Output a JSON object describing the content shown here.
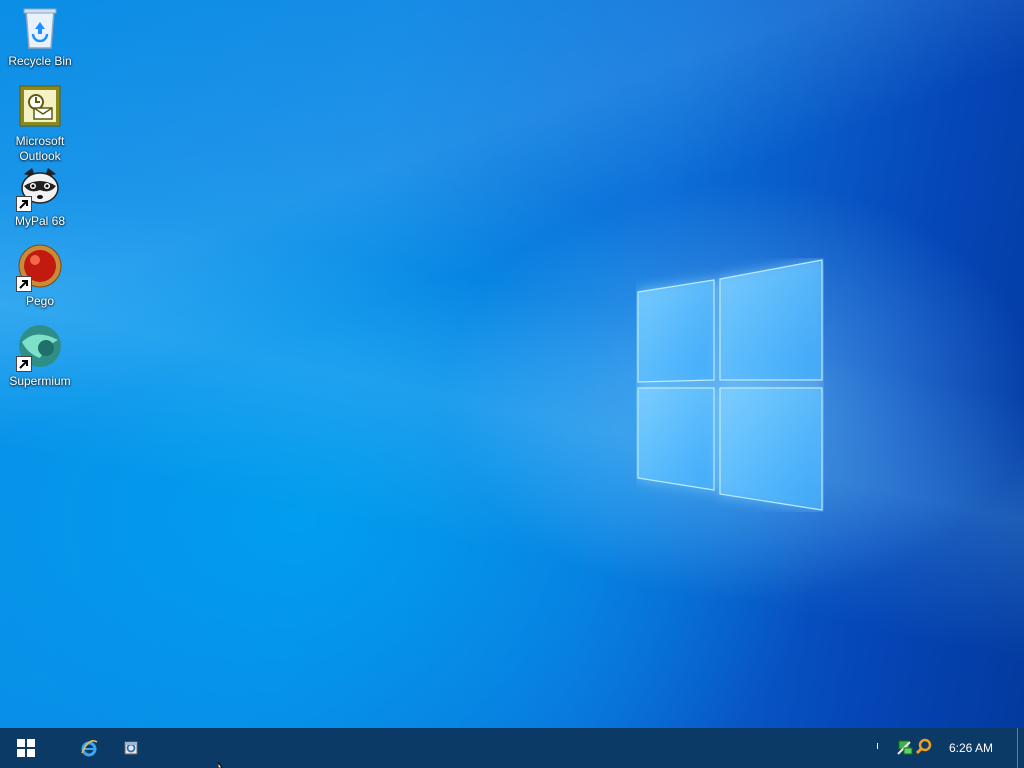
{
  "desktop": {
    "icons": [
      {
        "label": "Recycle Bin",
        "icon": "recycle-bin-icon",
        "shortcut": false
      },
      {
        "label": "Microsoft Outlook",
        "icon": "outlook-icon",
        "shortcut": false
      },
      {
        "label": "MyPal 68",
        "icon": "mypal-raccoon-icon",
        "shortcut": true
      },
      {
        "label": "Pego",
        "icon": "pego-red-orb-icon",
        "shortcut": true
      },
      {
        "label": "Supermium",
        "icon": "supermium-icon",
        "shortcut": true
      }
    ]
  },
  "taskbar": {
    "start_icon": "windows-start-icon",
    "pinned": [
      {
        "icon": "internet-explorer-icon"
      },
      {
        "icon": "generic-app-icon"
      }
    ],
    "tray": {
      "overflow_glyph": "ı",
      "icons": [
        "network-icon",
        "search-magnifier-icon"
      ],
      "clock": "6:26 AM"
    }
  },
  "colors": {
    "taskbar_bg": "#0c3a66",
    "desktop_blue": "#0b86e4"
  }
}
